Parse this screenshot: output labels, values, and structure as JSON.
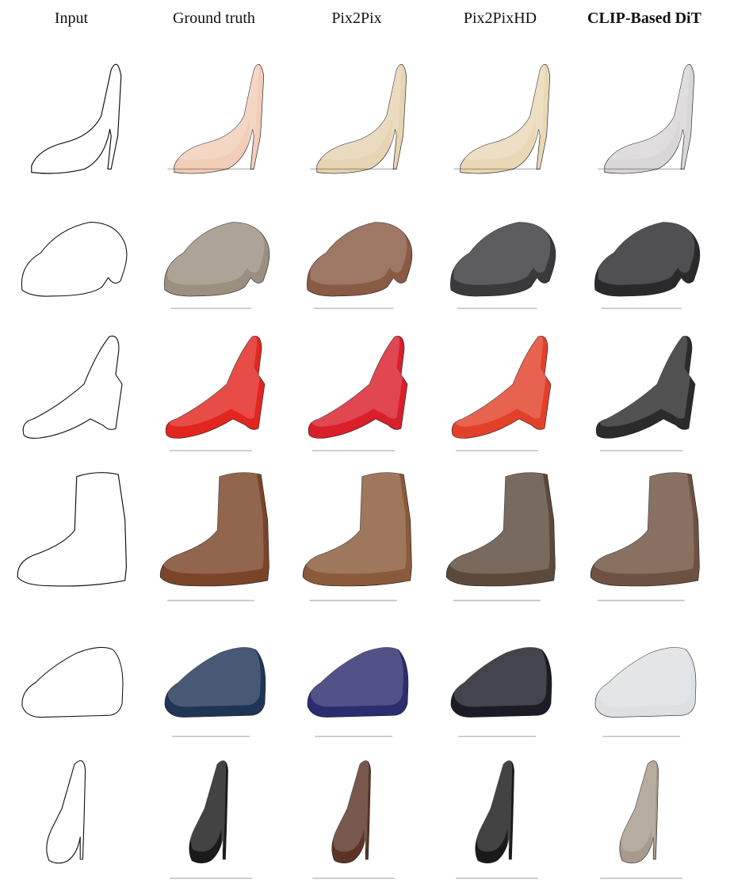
{
  "figure": {
    "columns": [
      {
        "key": "input",
        "label": "Input",
        "bold": false
      },
      {
        "key": "gt",
        "label": "Ground truth",
        "bold": false
      },
      {
        "key": "p2p",
        "label": "Pix2Pix",
        "bold": false
      },
      {
        "key": "p2phd",
        "label": "Pix2PixHD",
        "bold": false
      },
      {
        "key": "clip",
        "label": "CLIP-Based DiT",
        "bold": true
      }
    ],
    "rows": [
      {
        "shoe": "high-heel-pump",
        "colors": {
          "gt": "#f2cdb8",
          "p2p": "#e6d4b2",
          "p2phd": "#e9d8b6",
          "clip": "#d9d6d8"
        }
      },
      {
        "shoe": "platform-sandal",
        "colors": {
          "gt": "#9b8f80",
          "p2p": "#8a5a44",
          "p2phd": "#3a3a3c",
          "clip": "#2a2a2c"
        }
      },
      {
        "shoe": "wedge-slingback",
        "colors": {
          "gt": "#e2251f",
          "p2p": "#d91f2a",
          "p2phd": "#e3402a",
          "clip": "#2b2b2b"
        }
      },
      {
        "shoe": "lace-up-boot",
        "colors": {
          "gt": "#7a4428",
          "p2p": "#8a5a3a",
          "p2phd": "#5b4a3c",
          "clip": "#6e5241"
        }
      },
      {
        "shoe": "sneaker",
        "colors": {
          "gt": "#1f3556",
          "p2p": "#2c2d6e",
          "p2phd": "#1b1c26",
          "clip": "#dde0e2"
        }
      },
      {
        "shoe": "stiletto-platform",
        "colors": {
          "gt": "#1a1a1a",
          "p2p": "#5b3426",
          "p2phd": "#1a1a1a",
          "clip": "#a89a8c"
        }
      }
    ]
  }
}
